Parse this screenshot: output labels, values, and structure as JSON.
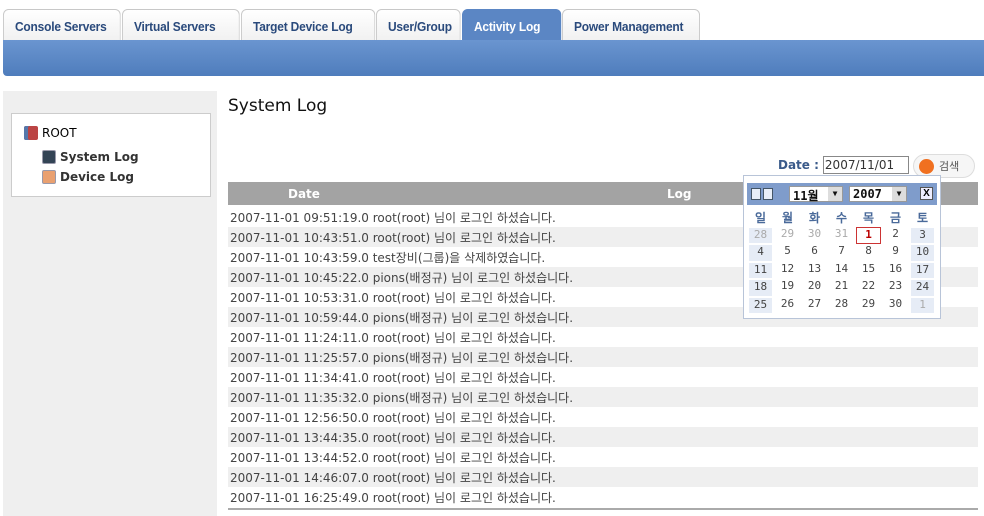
{
  "tabs": [
    "Console Servers",
    "Virtual Servers",
    "Target Device Log",
    "User/Group",
    "Activity Log",
    "Power Management"
  ],
  "active_tab": "Activity Log",
  "tree": {
    "root": "ROOT",
    "items": [
      "System Log",
      "Device Log"
    ]
  },
  "page_title": "System Log",
  "filter": {
    "date_label": "Date :",
    "date_value": "2007/11/01",
    "search_label": "검색"
  },
  "table": {
    "headers": [
      "Date",
      "Log"
    ],
    "rows": [
      "2007-11-01 09:51:19.0 root(root) 님이 로그인 하셨습니다.",
      "2007-11-01 10:43:51.0 root(root) 님이 로그인 하셨습니다.",
      "2007-11-01 10:43:59.0 test장비(그룹)을 삭제하였습니다.",
      "2007-11-01 10:45:22.0 pions(배정규) 님이 로그인 하셨습니다.",
      "2007-11-01 10:53:31.0 root(root) 님이 로그인 하셨습니다.",
      "2007-11-01 10:59:44.0 pions(배정규) 님이 로그인 하셨습니다.",
      "2007-11-01 11:24:11.0 root(root) 님이 로그인 하셨습니다.",
      "2007-11-01 11:25:57.0 pions(배정규) 님이 로그인 하셨습니다.",
      "2007-11-01 11:34:41.0 root(root) 님이 로그인 하셨습니다.",
      "2007-11-01 11:35:32.0 pions(배정규) 님이 로그인 하셨습니다.",
      "2007-11-01 12:56:50.0 root(root) 님이 로그인 하셨습니다.",
      "2007-11-01 13:44:35.0 root(root) 님이 로그인 하셨습니다.",
      "2007-11-01 13:44:52.0 root(root) 님이 로그인 하셨습니다.",
      "2007-11-01 14:46:07.0 root(root) 님이 로그인 하셨습니다.",
      "2007-11-01 16:25:49.0 root(root) 님이 로그인 하셨습니다."
    ]
  },
  "calendar": {
    "month": "11월",
    "year": "2007",
    "close": "X",
    "weekdays": [
      "일",
      "월",
      "화",
      "수",
      "목",
      "금",
      "토"
    ],
    "days": [
      "28",
      "29",
      "30",
      "31",
      "1",
      "2",
      "3",
      "4",
      "5",
      "6",
      "7",
      "8",
      "9",
      "10",
      "11",
      "12",
      "13",
      "14",
      "15",
      "16",
      "17",
      "18",
      "19",
      "20",
      "21",
      "22",
      "23",
      "24",
      "25",
      "26",
      "27",
      "28",
      "29",
      "30",
      "1"
    ],
    "selected": "1"
  }
}
